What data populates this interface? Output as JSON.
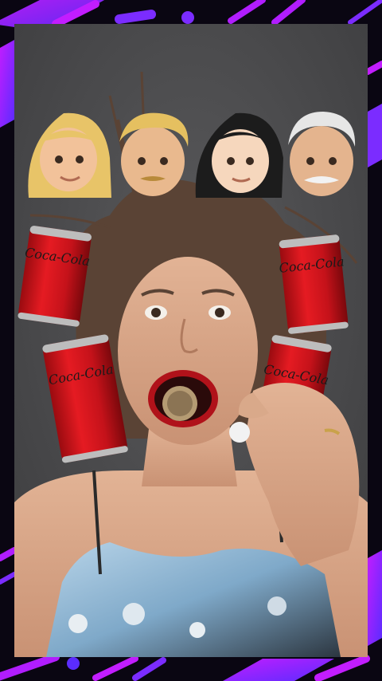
{
  "colors": {
    "frame_background": "#0a0612",
    "frame_accent_violet": "#7b2cff",
    "frame_accent_magenta": "#c21dff",
    "photo_background": "#4a4a4c",
    "can_red": "#d8141c",
    "skin": "#d9a98a",
    "hair_brown": "#5a4335"
  },
  "emoji_faces": [
    {
      "icon": "blonde-woman-emoji-icon"
    },
    {
      "icon": "blond-man-with-mustache-emoji-icon"
    },
    {
      "icon": "black-haired-woman-emoji-icon"
    },
    {
      "icon": "gray-haired-older-man-emoji-icon"
    }
  ],
  "cans": [
    {
      "icon": "cola-can-icon",
      "label": "Coca-Cola"
    },
    {
      "icon": "cola-can-icon",
      "label": "Coca-Cola"
    },
    {
      "icon": "cola-can-icon",
      "label": "Coca-Cola"
    },
    {
      "icon": "cola-can-icon",
      "label": "Coca-Cola"
    }
  ]
}
